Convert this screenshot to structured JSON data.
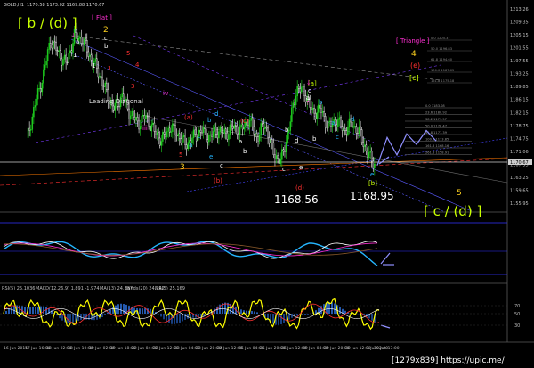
{
  "window": {
    "symbol": "GOLD,H1",
    "ohlc": "1170.58 1173.02 1169.88 1170.67"
  },
  "colors": {
    "background": "#000000",
    "bull_candle": "#1fd01f",
    "bear_candle": "#ffffff",
    "bid_line": "#cfcfcf",
    "wave_label_white": "#ffffff",
    "wave_label_red": "#ff3030",
    "wave_label_yellow": "#ffd21f",
    "wave_label_green": "#c8ff00",
    "wave_label_blue": "#25b6ff",
    "wave_label_magenta": "#ff2fd3",
    "projection_arrows": "#8f8fff"
  },
  "annotations": {
    "big_b_label": "[ b / (d) ]",
    "flat_label": "[ Flat ]",
    "leading_diagonal_label": "Leading Diagonal",
    "triangle_label": "[ Triangle ]",
    "big_c_label": "[ c / (d) ]",
    "level_d": "1168.56",
    "level_b": "1168.95",
    "wave_4": "4",
    "wave_e_paren": "(e)",
    "wave_c_bracket": "[c]",
    "wave_5": "5",
    "wave_2": "2",
    "wave_3": "3"
  },
  "price_scale": [
    "1213.26",
    "1209.35",
    "1205.15",
    "1201.55",
    "1197.55",
    "1193.25",
    "1189.85",
    "1186.15",
    "1182.15",
    "1178.75",
    "1174.75",
    "1171.06",
    "1167.95",
    "1163.25",
    "1159.65",
    "1155.95"
  ],
  "time_axis": [
    "16 Jun 2015",
    "17 Jun 16:00",
    "18 Jun 02:00",
    "18 Jun 10:00",
    "19 Jun 02:00",
    "19 Jun 18:00",
    "22 Jun 04:00",
    "22 Jun 12:00",
    "23 Jun 04:00",
    "23 Jun 20:00",
    "24 Jun 12:00",
    "25 Jun 04:00",
    "25 Jun 20:00",
    "26 Jun 12:00",
    "29 Jun 04:00",
    "29 Jun 20:00",
    "30 Jun 12:00",
    "1 Jul 02:00",
    "30 Jun 17:00"
  ],
  "indicators": {
    "osc1_name": "",
    "rsi_label": "RSI(5) 25.1036",
    "macd_label": "MACD(12,26,9) 1.891 -1.974",
    "ma_label": "MA(13) 24.187",
    "bands_label": "Bands(20) 24.292",
    "ma2_label": "MA(5) 25.169",
    "osc2_levels": [
      "70",
      "50",
      "30"
    ]
  },
  "fib_levels": [
    "0.0 1183.08",
    "23.6 1180.92",
    "38.2 1179.57",
    "50.0 1178.47",
    "61.8 1177.39",
    "100.0 1173.85",
    "161.8 1168.16",
    "261.8 1158.91"
  ],
  "fib_upper": [
    "0.0 1205.37",
    "50.0 1196.83",
    "61.8 1194.60",
    "100.0 1187.05",
    "161.8 1175.18"
  ],
  "chart_data": {
    "type": "candlestick",
    "title": "GOLD,H1",
    "subtitle": "1170.58 1173.02 1169.88 1170.67",
    "last_price": 1170.67,
    "levels": [
      1168.56,
      1168.95
    ],
    "ylim": [
      1155.95,
      1213.26
    ],
    "x_ticks": [
      "16 Jun 2015",
      "17 Jun 16:00",
      "18 Jun 02:00",
      "18 Jun 10:00",
      "19 Jun 02:00",
      "19 Jun 18:00",
      "22 Jun 04:00",
      "22 Jun 12:00",
      "23 Jun 04:00",
      "23 Jun 20:00",
      "24 Jun 12:00",
      "25 Jun 04:00",
      "25 Jun 20:00",
      "26 Jun 12:00",
      "29 Jun 04:00",
      "29 Jun 20:00",
      "30 Jun 12:00",
      "1 Jul 02:00"
    ],
    "close_path": [
      1175,
      1185,
      1193,
      1204,
      1200,
      1197,
      1205,
      1204,
      1199,
      1195,
      1189,
      1184,
      1188,
      1183,
      1180,
      1182,
      1178,
      1175,
      1179,
      1177,
      1174,
      1176,
      1178,
      1176,
      1178,
      1177,
      1179,
      1178,
      1181,
      1176,
      1180,
      1172,
      1169,
      1178,
      1190,
      1189,
      1183,
      1184,
      1179,
      1181,
      1178,
      1180,
      1177,
      1171,
      1168
    ],
    "projection": [
      1168,
      1176,
      1171,
      1177,
      1174,
      1178,
      1175
    ]
  }
}
